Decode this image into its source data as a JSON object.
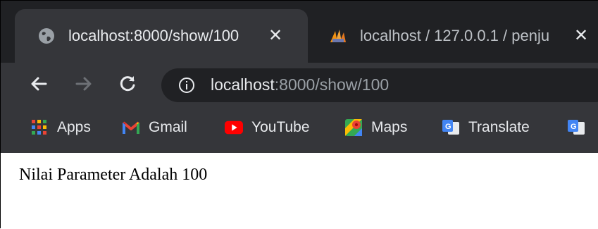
{
  "tabs": [
    {
      "title": "localhost:8000/show/100",
      "icon": "globe-icon",
      "active": true,
      "close": "✕"
    },
    {
      "title": "localhost / 127.0.0.1 / penju",
      "icon": "phpmyadmin-icon",
      "active": false,
      "close": "✕"
    }
  ],
  "toolbar": {
    "url_host": "localhost",
    "url_rest": ":8000/show/100"
  },
  "bookmarks": [
    {
      "label": "Apps",
      "icon": "apps-grid-icon"
    },
    {
      "label": "Gmail",
      "icon": "gmail-icon"
    },
    {
      "label": "YouTube",
      "icon": "youtube-icon"
    },
    {
      "label": "Maps",
      "icon": "maps-icon"
    },
    {
      "label": "Translate",
      "icon": "translate-icon"
    }
  ],
  "page": {
    "text": "Nilai Parameter Adalah 100"
  },
  "colors": {
    "tabstrip": "#202124",
    "toolbar": "#35363a",
    "omnibox": "#202124",
    "text_light": "#e8eaed",
    "text_dim": "#9aa0a6"
  }
}
